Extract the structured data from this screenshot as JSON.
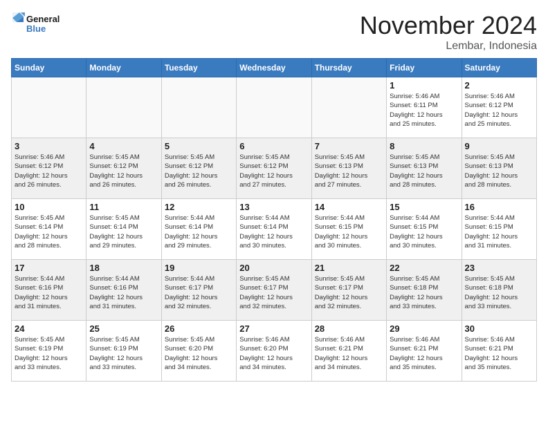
{
  "logo": {
    "general": "General",
    "blue": "Blue"
  },
  "header": {
    "month": "November 2024",
    "location": "Lembar, Indonesia"
  },
  "weekdays": [
    "Sunday",
    "Monday",
    "Tuesday",
    "Wednesday",
    "Thursday",
    "Friday",
    "Saturday"
  ],
  "weeks": [
    [
      {
        "day": "",
        "info": ""
      },
      {
        "day": "",
        "info": ""
      },
      {
        "day": "",
        "info": ""
      },
      {
        "day": "",
        "info": ""
      },
      {
        "day": "",
        "info": ""
      },
      {
        "day": "1",
        "info": "Sunrise: 5:46 AM\nSunset: 6:11 PM\nDaylight: 12 hours\nand 25 minutes."
      },
      {
        "day": "2",
        "info": "Sunrise: 5:46 AM\nSunset: 6:12 PM\nDaylight: 12 hours\nand 25 minutes."
      }
    ],
    [
      {
        "day": "3",
        "info": "Sunrise: 5:46 AM\nSunset: 6:12 PM\nDaylight: 12 hours\nand 26 minutes."
      },
      {
        "day": "4",
        "info": "Sunrise: 5:45 AM\nSunset: 6:12 PM\nDaylight: 12 hours\nand 26 minutes."
      },
      {
        "day": "5",
        "info": "Sunrise: 5:45 AM\nSunset: 6:12 PM\nDaylight: 12 hours\nand 26 minutes."
      },
      {
        "day": "6",
        "info": "Sunrise: 5:45 AM\nSunset: 6:12 PM\nDaylight: 12 hours\nand 27 minutes."
      },
      {
        "day": "7",
        "info": "Sunrise: 5:45 AM\nSunset: 6:13 PM\nDaylight: 12 hours\nand 27 minutes."
      },
      {
        "day": "8",
        "info": "Sunrise: 5:45 AM\nSunset: 6:13 PM\nDaylight: 12 hours\nand 28 minutes."
      },
      {
        "day": "9",
        "info": "Sunrise: 5:45 AM\nSunset: 6:13 PM\nDaylight: 12 hours\nand 28 minutes."
      }
    ],
    [
      {
        "day": "10",
        "info": "Sunrise: 5:45 AM\nSunset: 6:14 PM\nDaylight: 12 hours\nand 28 minutes."
      },
      {
        "day": "11",
        "info": "Sunrise: 5:45 AM\nSunset: 6:14 PM\nDaylight: 12 hours\nand 29 minutes."
      },
      {
        "day": "12",
        "info": "Sunrise: 5:44 AM\nSunset: 6:14 PM\nDaylight: 12 hours\nand 29 minutes."
      },
      {
        "day": "13",
        "info": "Sunrise: 5:44 AM\nSunset: 6:14 PM\nDaylight: 12 hours\nand 30 minutes."
      },
      {
        "day": "14",
        "info": "Sunrise: 5:44 AM\nSunset: 6:15 PM\nDaylight: 12 hours\nand 30 minutes."
      },
      {
        "day": "15",
        "info": "Sunrise: 5:44 AM\nSunset: 6:15 PM\nDaylight: 12 hours\nand 30 minutes."
      },
      {
        "day": "16",
        "info": "Sunrise: 5:44 AM\nSunset: 6:15 PM\nDaylight: 12 hours\nand 31 minutes."
      }
    ],
    [
      {
        "day": "17",
        "info": "Sunrise: 5:44 AM\nSunset: 6:16 PM\nDaylight: 12 hours\nand 31 minutes."
      },
      {
        "day": "18",
        "info": "Sunrise: 5:44 AM\nSunset: 6:16 PM\nDaylight: 12 hours\nand 31 minutes."
      },
      {
        "day": "19",
        "info": "Sunrise: 5:44 AM\nSunset: 6:17 PM\nDaylight: 12 hours\nand 32 minutes."
      },
      {
        "day": "20",
        "info": "Sunrise: 5:45 AM\nSunset: 6:17 PM\nDaylight: 12 hours\nand 32 minutes."
      },
      {
        "day": "21",
        "info": "Sunrise: 5:45 AM\nSunset: 6:17 PM\nDaylight: 12 hours\nand 32 minutes."
      },
      {
        "day": "22",
        "info": "Sunrise: 5:45 AM\nSunset: 6:18 PM\nDaylight: 12 hours\nand 33 minutes."
      },
      {
        "day": "23",
        "info": "Sunrise: 5:45 AM\nSunset: 6:18 PM\nDaylight: 12 hours\nand 33 minutes."
      }
    ],
    [
      {
        "day": "24",
        "info": "Sunrise: 5:45 AM\nSunset: 6:19 PM\nDaylight: 12 hours\nand 33 minutes."
      },
      {
        "day": "25",
        "info": "Sunrise: 5:45 AM\nSunset: 6:19 PM\nDaylight: 12 hours\nand 33 minutes."
      },
      {
        "day": "26",
        "info": "Sunrise: 5:45 AM\nSunset: 6:20 PM\nDaylight: 12 hours\nand 34 minutes."
      },
      {
        "day": "27",
        "info": "Sunrise: 5:46 AM\nSunset: 6:20 PM\nDaylight: 12 hours\nand 34 minutes."
      },
      {
        "day": "28",
        "info": "Sunrise: 5:46 AM\nSunset: 6:21 PM\nDaylight: 12 hours\nand 34 minutes."
      },
      {
        "day": "29",
        "info": "Sunrise: 5:46 AM\nSunset: 6:21 PM\nDaylight: 12 hours\nand 35 minutes."
      },
      {
        "day": "30",
        "info": "Sunrise: 5:46 AM\nSunset: 6:21 PM\nDaylight: 12 hours\nand 35 minutes."
      }
    ]
  ]
}
